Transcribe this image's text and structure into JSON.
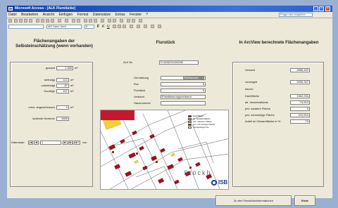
{
  "window": {
    "title": "Microsoft Access - [ALK Flurstücke]",
    "min_label": "_",
    "max_label": "□",
    "close_label": "×"
  },
  "menu": [
    "Datei",
    "Bearbeiten",
    "Ansicht",
    "Einfügen",
    "Format",
    "Datensätze",
    "Extras",
    "Fenster",
    "?"
  ],
  "help_placeholder": "Frage hier eingeben",
  "format_bar": {
    "object_combo": "",
    "font_combo": "MS Sans Serif",
    "size_combo": "8",
    "bold": "F",
    "italic": "K",
    "underline": "U"
  },
  "left": {
    "title": "Flächenangaben der Selbsteinschätzung (wenn vorhanden)",
    "gesamt_label": "gesamt",
    "gesamt_value": "1.365",
    "gesamt_unit": "m²",
    "befestigt_label": "befestigt",
    "befestigt_value": "414",
    "befestigt_unit": "m²",
    "unbebaut_label": "unbefestigt",
    "unbebaut_value": "87",
    "unbebaut_unit": "m²",
    "sonstige_label": "Sonstige",
    "sonstige_value": "157",
    "sonstige_unit": "m²",
    "mind_label": "mind. angeschlossen",
    "mind_value": "0",
    "mind_unit": "m²",
    "laufende_label": "laufende Nummer",
    "laufende_value": "3466",
    "record_label": "Datensatz:",
    "nav_first": "|◄",
    "nav_prev": "◄",
    "record_number": "1",
    "nav_next": "►",
    "nav_last": "►|",
    "nav_new": "►*",
    "record_total": "von"
  },
  "middle": {
    "title": "Flurstück",
    "alk_label": "ALK Nr.",
    "alk_value": "FLD06231000000",
    "gemarkung_label": "Gemarkung",
    "gemarkung_value": "Stellhausen",
    "flur_label": "Flur",
    "flur_value": "6",
    "flurstueck_label": "Flurstück",
    "flurstueck_value": "6",
    "verband_label": "Verband",
    "verband_value": "Entwässerungsverband",
    "hausnummer_label": "Hausnummer",
    "hausnummer_value": ""
  },
  "right": {
    "title": "In ArcView berechnete Flächenangaben",
    "gesamt_label": "Gesamt",
    "gesamt_value": "2858,432",
    "versiegelt_label": "versiegelt",
    "versiegelt_value": "2090,347",
    "davon_label": "davon:",
    "dachflaeche_label": "Dachfläche",
    "dachflaeche_value": "1362,234",
    "verkehrsflaeche_label": "alt. Verkehrsfläche",
    "verkehrsflaeche_value": "74,913",
    "sauber_label": "priv. saubere Fläche",
    "sauber_value": "0",
    "schmutzig_label": "priv. schmutzige Fläche",
    "schmutzig_value": "410,514",
    "anteil_label": "Anteil an Gesamtfläche in %",
    "anteil_value": "73"
  },
  "map": {
    "legend": [
      {
        "label": "Dachfläche",
        "color": "#a01020"
      },
      {
        "label": "alt. Verkehrsfläche",
        "color": "#9a9a9a"
      },
      {
        "label": "priv. saubere Fläche",
        "color": "#f2d23a"
      },
      {
        "label": "priv. schmutzige Fläche",
        "color": "#7b3a10"
      },
      {
        "label": "Flurstücksgrenze",
        "color": "#ffffff"
      }
    ],
    "logo_text": "ISB",
    "street_text": "Stöckh"
  },
  "buttons": {
    "info": "Zu den Flurstücksinformationen",
    "end": "Ende"
  }
}
